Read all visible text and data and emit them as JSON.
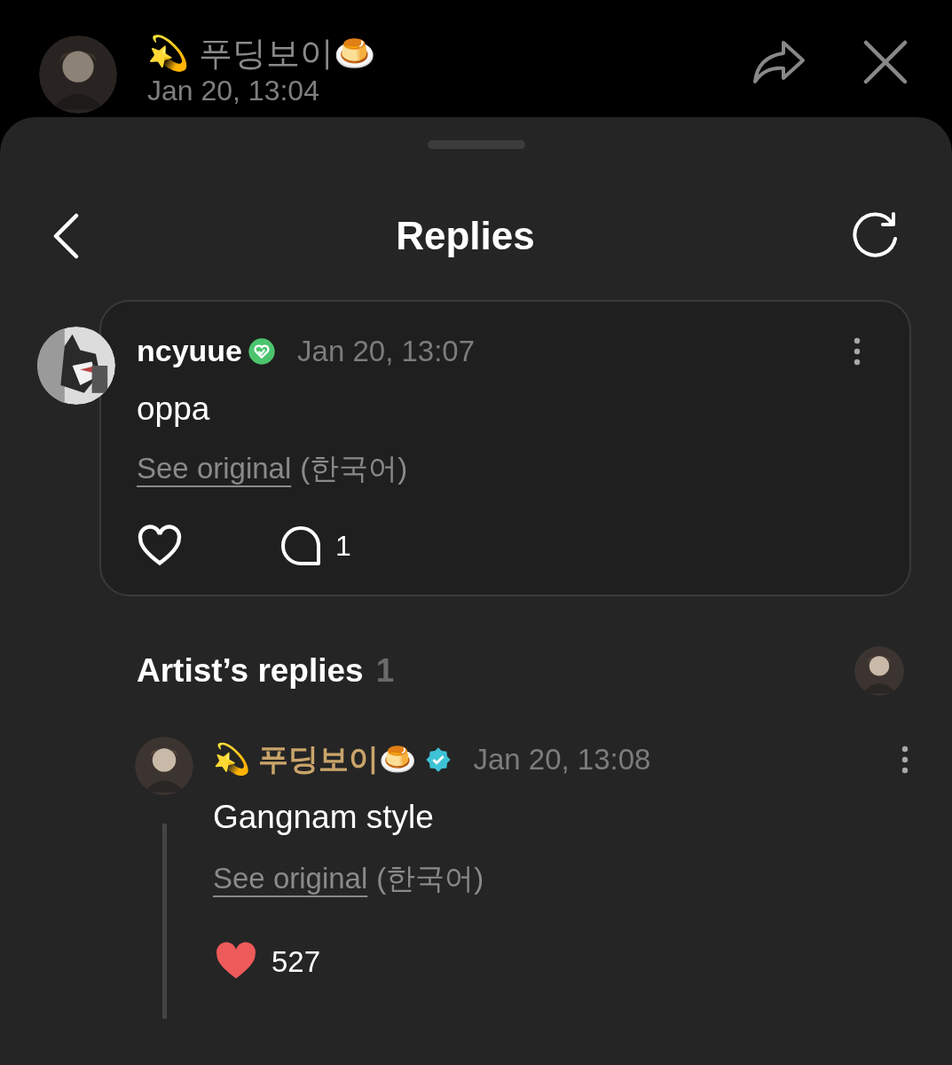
{
  "top_bar": {
    "author": "💫 푸딩보이🍮",
    "time": "Jan 20, 13:04"
  },
  "header": {
    "title": "Replies"
  },
  "comment": {
    "author": "ncyuue",
    "time": "Jan 20, 13:07",
    "text": "oppa",
    "see_original": "See original",
    "language": "(한국어)",
    "liked": false,
    "reply_count": "1"
  },
  "artist_replies": {
    "title": "Artist’s replies",
    "count": "1",
    "replies": [
      {
        "author": "💫 푸딩보이🍮",
        "time": "Jan 20, 13:08",
        "text": "Gangnam style",
        "see_original": "See original",
        "language": "(한국어)",
        "liked": true,
        "like_count": "527"
      }
    ]
  }
}
